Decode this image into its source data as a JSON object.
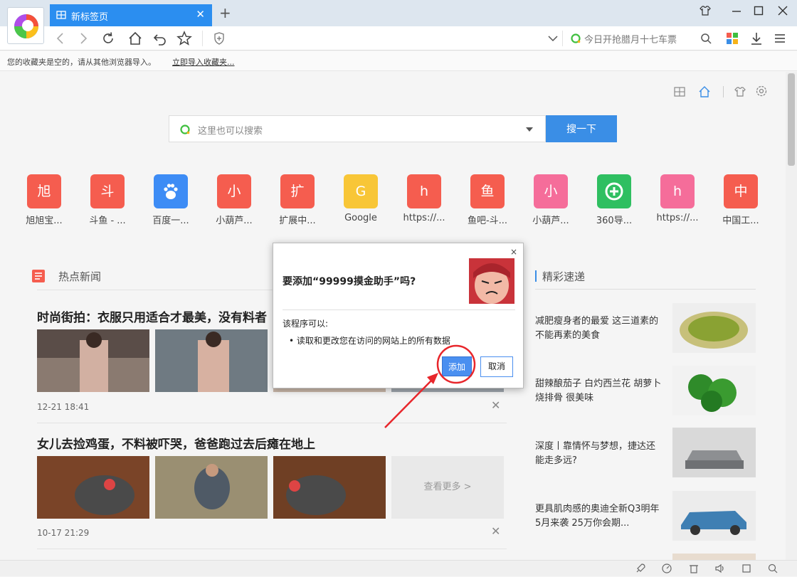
{
  "browser": {
    "tab_title": "新标签页",
    "tab_close": "✕",
    "new_tab": "+",
    "nav_search_text": "今日开抢腊月十七车票"
  },
  "favbar": {
    "empty_message": "您的收藏夹是空的，请从其他浏览器导入。",
    "import_link": "立即导入收藏夹..."
  },
  "search": {
    "placeholder": "这里也可以搜索",
    "button_label": "搜一下"
  },
  "sites": [
    {
      "glyph": "旭",
      "label": "旭旭宝...",
      "color": "#f55d4f"
    },
    {
      "glyph": "斗",
      "label": "斗鱼 - ...",
      "color": "#f55d4f"
    },
    {
      "glyph": "",
      "label": "百度一...",
      "color": "#3d8cf5"
    },
    {
      "glyph": "小",
      "label": "小葫芦...",
      "color": "#f55d4f"
    },
    {
      "glyph": "扩",
      "label": "扩展中...",
      "color": "#f55d4f"
    },
    {
      "glyph": "G",
      "label": "Google",
      "color": "#f8c637"
    },
    {
      "glyph": "h",
      "label": "https://...",
      "color": "#f55d4f"
    },
    {
      "glyph": "鱼",
      "label": "鱼吧-斗...",
      "color": "#f55d4f"
    },
    {
      "glyph": "小",
      "label": "小葫芦...",
      "color": "#f56d9a"
    },
    {
      "glyph": "",
      "label": "360导...",
      "color": "#2fbf61"
    },
    {
      "glyph": "h",
      "label": "https://...",
      "color": "#f56d9a"
    },
    {
      "glyph": "中",
      "label": "中国工...",
      "color": "#f55d4f"
    }
  ],
  "news": {
    "heading": "热点新闻",
    "items": [
      {
        "title": "时尚街拍：衣服只用适合才最美，没有料者",
        "time": "12-21 18:41"
      },
      {
        "title": "女儿去捡鸡蛋，不料被吓哭，爸爸跑过去后瘫在地上",
        "time": "10-17 21:29"
      }
    ],
    "more_label": "查看更多 >"
  },
  "featured": {
    "heading": "精彩速递",
    "items": [
      {
        "text": "减肥瘦身者的最爱 这三道素的不能再素的美食"
      },
      {
        "text": "甜辣酿茄子 白灼西兰花 胡萝卜烧排骨 很美味"
      },
      {
        "text": "深度丨靠情怀与梦想，捷达还能走多远?"
      },
      {
        "text": "更具肌肉感的奥迪全新Q3明年5月来袭 25万你会期..."
      }
    ]
  },
  "dialog": {
    "title": "要添加“99999摸金助手”吗?",
    "close": "×",
    "permissions_heading": "该程序可以:",
    "permission_item": "读取和更改您在访问的网站上的所有数据",
    "add_label": "添加",
    "cancel_label": "取消"
  }
}
